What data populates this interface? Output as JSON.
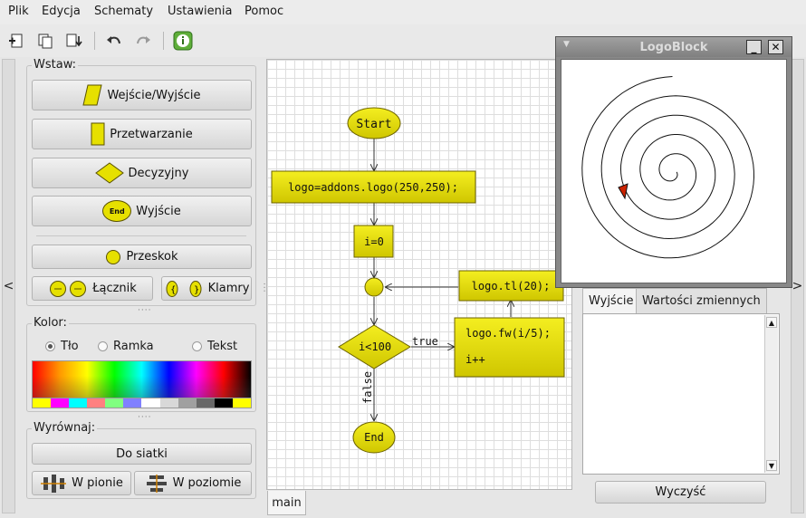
{
  "menu": [
    "Plik",
    "Edycja",
    "Schematy",
    "Ustawienia",
    "Pomoc"
  ],
  "toolbar": {
    "icons": [
      "new-file-icon",
      "copy-icon",
      "save-icon",
      "undo-icon",
      "redo-icon",
      "info-icon"
    ]
  },
  "side": {
    "left_arrow": "<",
    "right_arrow": ">"
  },
  "insert": {
    "title": "Wstaw:",
    "io": "Wejście/Wyjście",
    "process": "Przetwarzanie",
    "decision": "Decyzyjny",
    "exit_badge": "End",
    "exit": "Wyjście",
    "jump": "Przeskok",
    "connector": "Łącznik",
    "brackets": "Klamry"
  },
  "color": {
    "title": "Kolor:",
    "options": [
      "Tło",
      "Ramka",
      "Tekst"
    ],
    "selected": "Tło",
    "swatches": [
      "#ffff00",
      "#ff00ff",
      "#00ffff",
      "#ff8080",
      "#80ff80",
      "#8080ff",
      "#ffffff",
      "#d8d8d8",
      "#a0a0a0",
      "#686868",
      "#000000",
      "#ffff00"
    ]
  },
  "align": {
    "title": "Wyrównaj:",
    "grid": "Do siatki",
    "vertical": "W pionie",
    "horizontal": "W poziomie"
  },
  "flowchart": {
    "start": "Start",
    "init": "logo=addons.logo(250,250);",
    "i_init": "i=0",
    "turn": "logo.tl(20);",
    "cond": "i<100",
    "body_line1": "logo.fw(i/5);",
    "body_line2": "i++",
    "true_label": "true",
    "false_label": "false",
    "end": "End",
    "colors": {
      "block": "#e6e000",
      "block_border": "#6b6200"
    }
  },
  "tabs": {
    "main": "main"
  },
  "logo_window": {
    "title": "LogoBlock"
  },
  "output": {
    "tabs": [
      "Wyjście",
      "Wartości zmiennych"
    ],
    "active_tab": "Wyjście",
    "clear": "Wyczyść"
  }
}
